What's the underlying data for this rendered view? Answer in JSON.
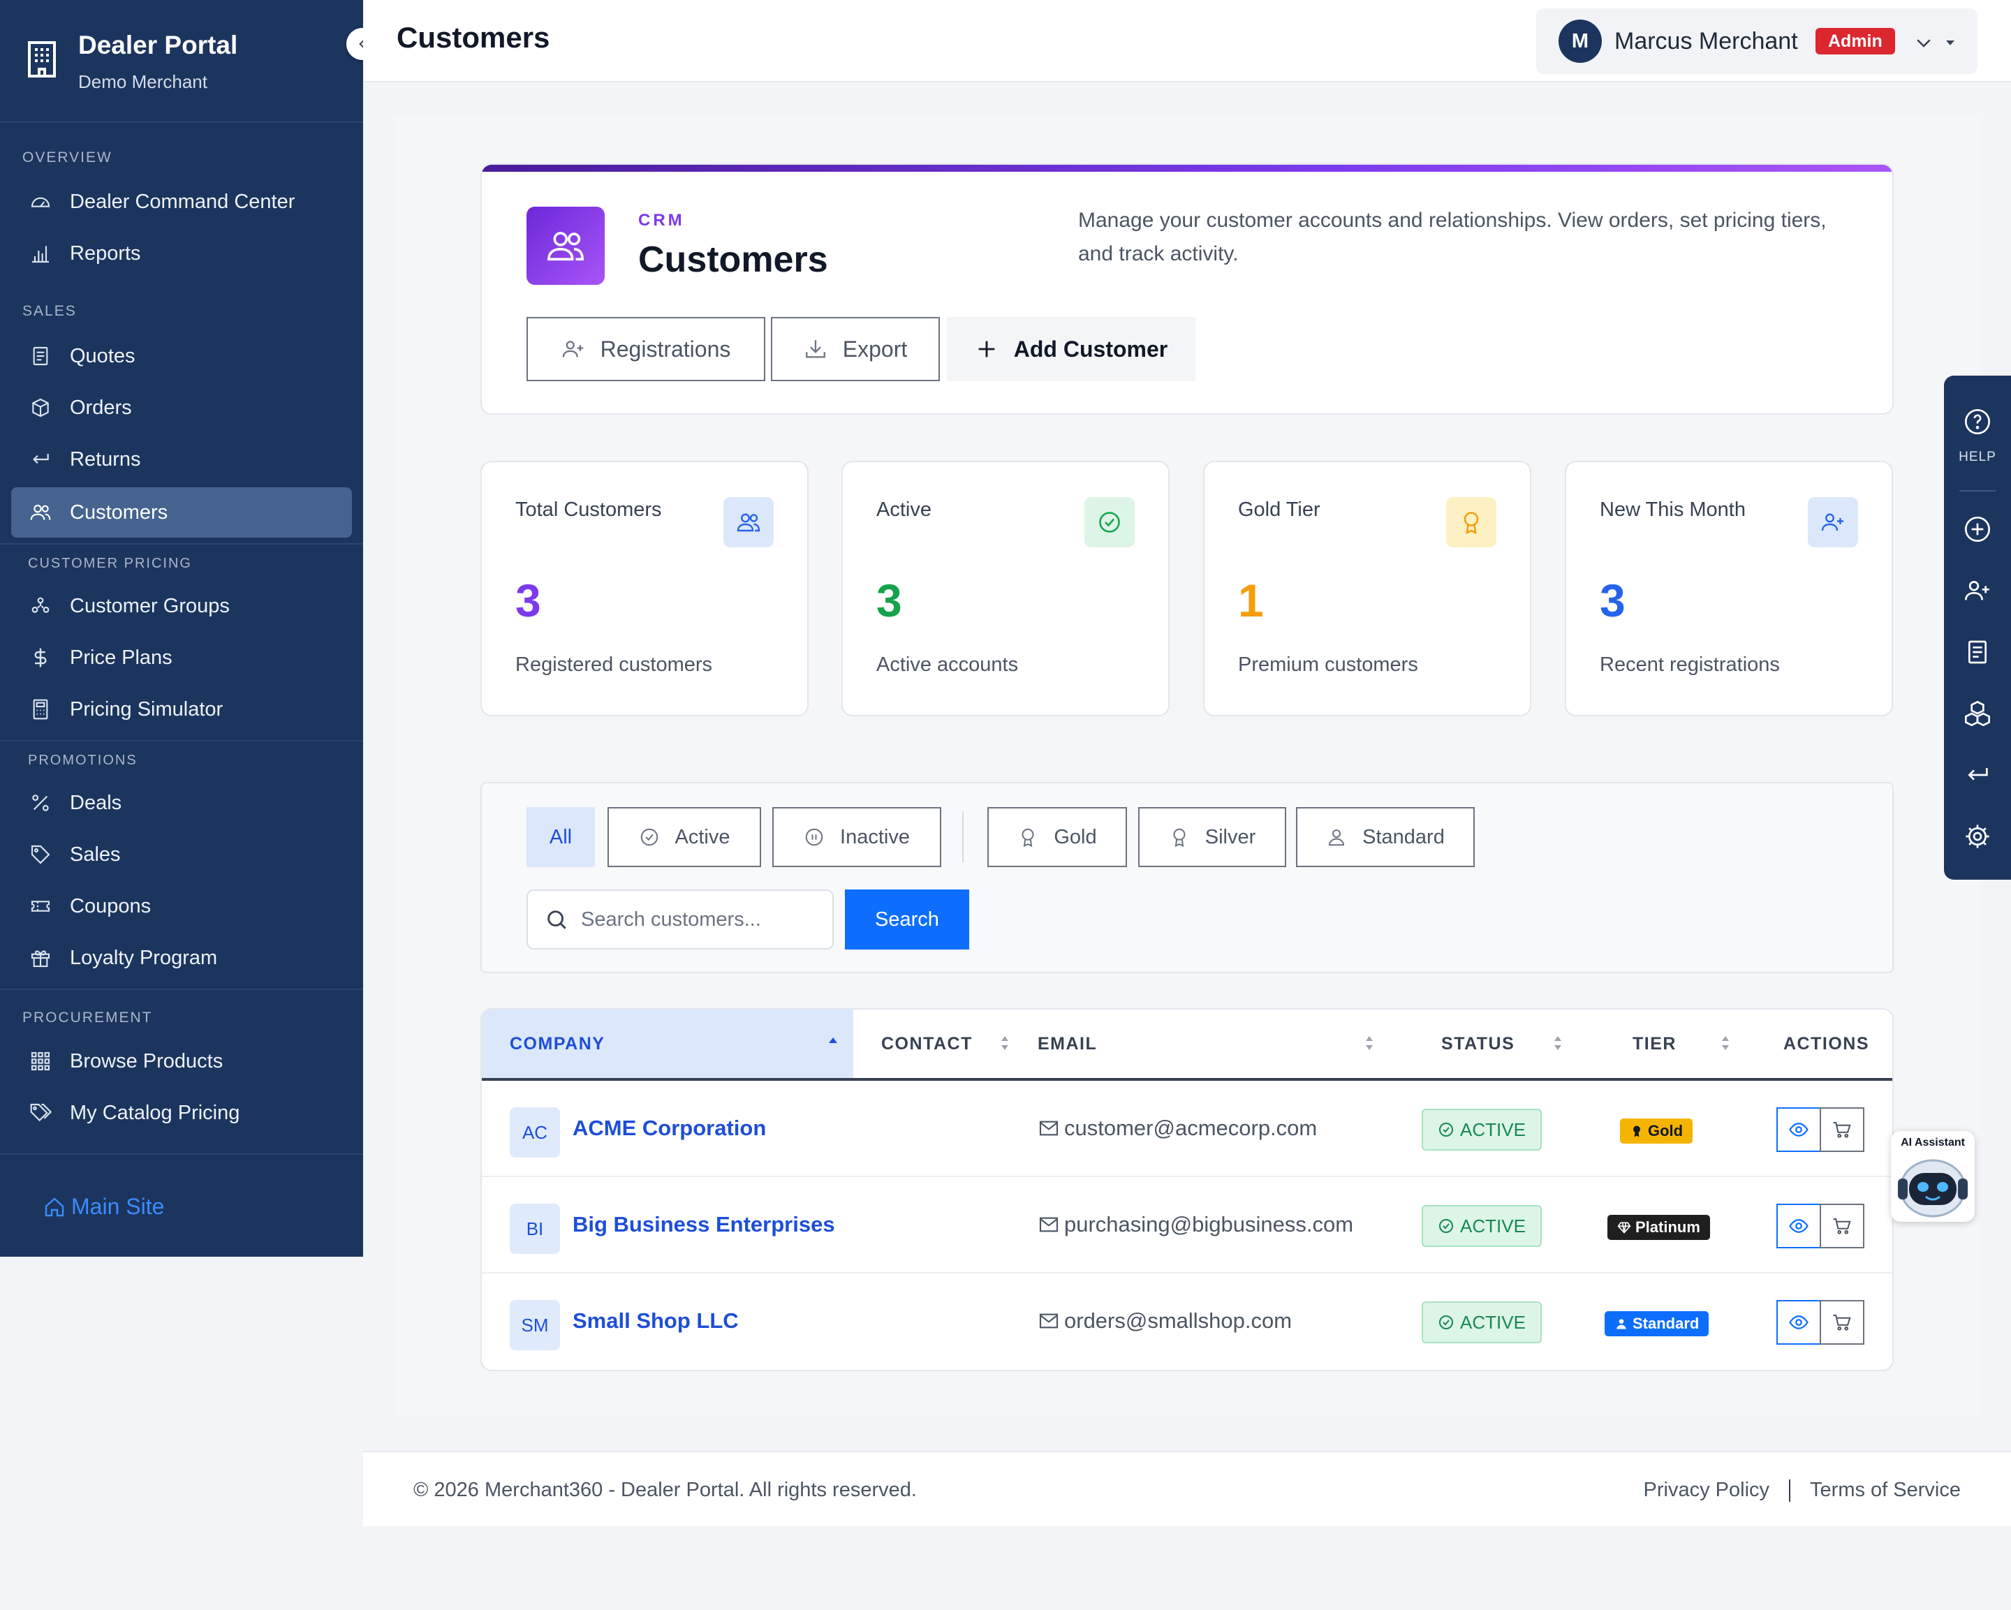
{
  "sidebar": {
    "brand_title": "Dealer Portal",
    "brand_subtitle": "Demo Merchant",
    "sections": {
      "overview": "OVERVIEW",
      "sales": "SALES",
      "customer_pricing": "CUSTOMER PRICING",
      "promotions": "PROMOTIONS",
      "procurement": "PROCUREMENT"
    },
    "items": {
      "dealer_command_center": "Dealer Command Center",
      "reports": "Reports",
      "quotes": "Quotes",
      "orders": "Orders",
      "returns": "Returns",
      "customers": "Customers",
      "customer_groups": "Customer Groups",
      "price_plans": "Price Plans",
      "pricing_simulator": "Pricing Simulator",
      "deals": "Deals",
      "sales": "Sales",
      "coupons": "Coupons",
      "loyalty_program": "Loyalty Program",
      "browse_products": "Browse Products",
      "my_catalog_pricing": "My Catalog Pricing"
    },
    "active_item": "Customers",
    "main_site": "Main Site"
  },
  "header": {
    "page_title": "Customers",
    "user_initial": "M",
    "user_name": "Marcus Merchant",
    "user_role": "Admin"
  },
  "hero": {
    "eyebrow": "CRM",
    "title": "Customers",
    "description": "Manage your customer accounts and relationships. View orders, set pricing tiers, and track activity.",
    "btn_registrations": "Registrations",
    "btn_export": "Export",
    "btn_add": "Add Customer"
  },
  "stats": [
    {
      "label": "Total Customers",
      "value": "3",
      "sub": "Registered customers",
      "color": "#7c3aed",
      "icon": "users-icon"
    },
    {
      "label": "Active",
      "value": "3",
      "sub": "Active accounts",
      "color": "#16a34a",
      "icon": "check-circle-icon"
    },
    {
      "label": "Gold Tier",
      "value": "1",
      "sub": "Premium customers",
      "color": "#f59e0b",
      "icon": "award-icon"
    },
    {
      "label": "New This Month",
      "value": "3",
      "sub": "Recent registrations",
      "color": "#2563eb",
      "icon": "user-plus-icon"
    }
  ],
  "filters": {
    "all": "All",
    "active": "Active",
    "inactive": "Inactive",
    "gold": "Gold",
    "silver": "Silver",
    "standard": "Standard",
    "search_placeholder": "Search customers...",
    "search_button": "Search"
  },
  "table": {
    "columns": {
      "company": "COMPANY",
      "contact": "CONTACT",
      "email": "EMAIL",
      "status": "STATUS",
      "tier": "TIER",
      "actions": "ACTIONS"
    },
    "rows": [
      {
        "initials": "AC",
        "company": "ACME Corporation",
        "contact": "",
        "email": "customer@acmecorp.com",
        "status": "ACTIVE",
        "tier": "Gold"
      },
      {
        "initials": "BI",
        "company": "Big Business Enterprises",
        "contact": "",
        "email": "purchasing@bigbusiness.com",
        "status": "ACTIVE",
        "tier": "Platinum"
      },
      {
        "initials": "SM",
        "company": "Small Shop LLC",
        "contact": "",
        "email": "orders@smallshop.com",
        "status": "ACTIVE",
        "tier": "Standard"
      }
    ]
  },
  "rail": {
    "help": "HELP"
  },
  "ai_assistant": "AI Assistant",
  "footer": {
    "copyright": "© 2026 Merchant360 - Dealer Portal. All rights reserved.",
    "privacy": "Privacy Policy",
    "terms": "Terms of Service"
  },
  "colors": {
    "sidebar": "#1c355e",
    "accent": "#0d6efd",
    "admin_badge": "#dc2630",
    "tier_gold": "#f5b400",
    "tier_platinum": "#1f1f1f",
    "tier_standard": "#0d6efd"
  }
}
